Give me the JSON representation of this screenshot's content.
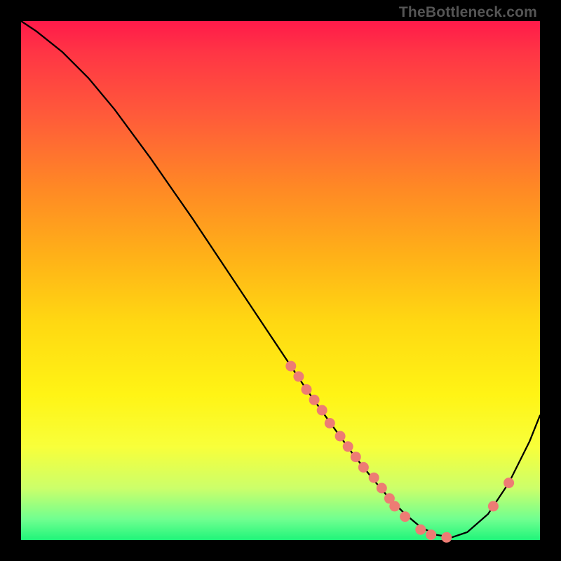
{
  "watermark": "TheBottleneck.com",
  "chart_data": {
    "type": "line",
    "title": "",
    "xlabel": "",
    "ylabel": "",
    "xlim": [
      0,
      100
    ],
    "ylim": [
      0,
      100
    ],
    "curve": {
      "name": "bottleneck-curve",
      "x": [
        0,
        3,
        8,
        13,
        18,
        25,
        33,
        41,
        49,
        55,
        60,
        64,
        68,
        71,
        74,
        77,
        80,
        83,
        86,
        90,
        94,
        98,
        100
      ],
      "y": [
        100,
        98,
        94,
        89,
        83,
        73.5,
        62,
        50,
        38,
        29,
        22,
        16.5,
        11.5,
        8,
        5,
        2.5,
        1,
        0.5,
        1.5,
        5,
        11,
        19,
        24
      ]
    },
    "series": [
      {
        "name": "marker-points",
        "type": "scatter",
        "color": "#ed7c74",
        "x": [
          52,
          53.5,
          55,
          56.5,
          58,
          59.5,
          61.5,
          63,
          64.5,
          66,
          68,
          69.5,
          71,
          72,
          74,
          77,
          79,
          82,
          91,
          94
        ],
        "y": [
          33.5,
          31.5,
          29,
          27,
          25,
          22.5,
          20,
          18,
          16,
          14,
          12,
          10,
          8,
          6.5,
          4.5,
          2,
          1,
          0.5,
          6.5,
          11
        ]
      }
    ]
  }
}
